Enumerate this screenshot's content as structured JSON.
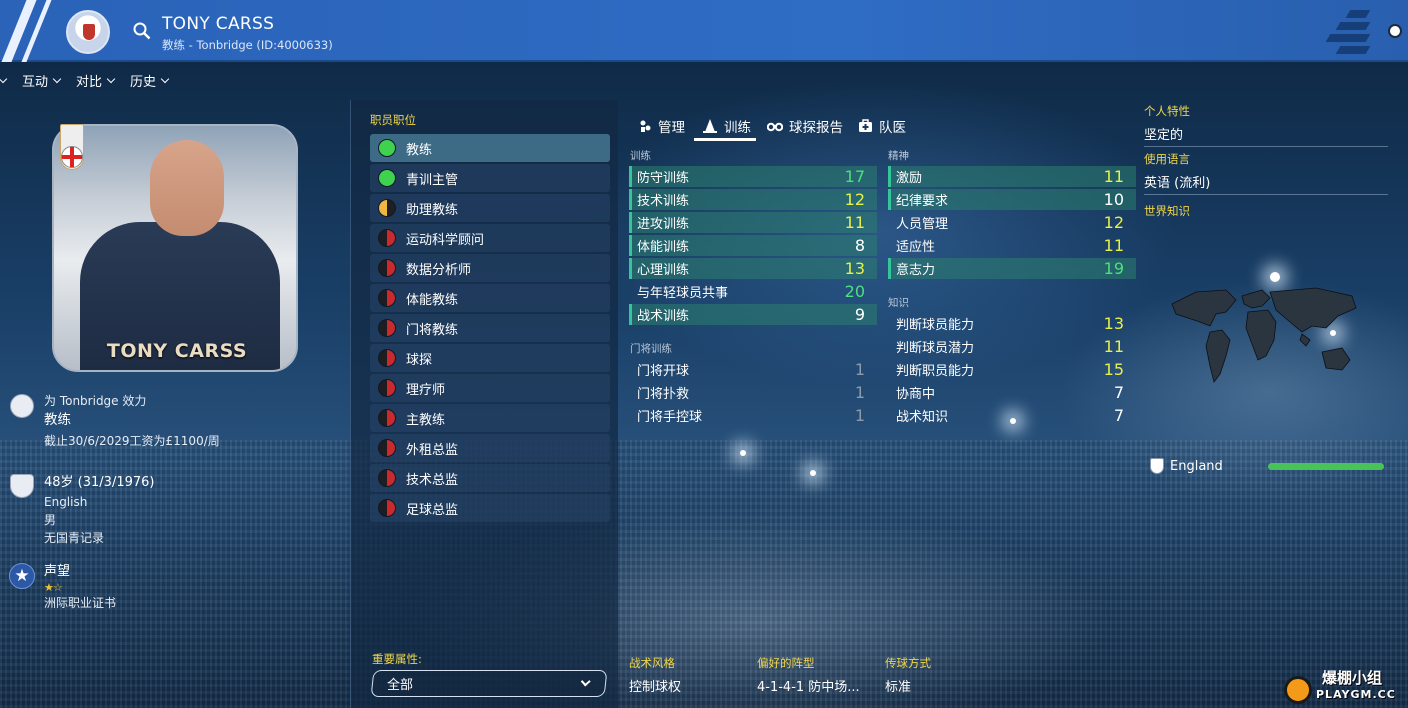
{
  "header": {
    "name": "TONY CARSS",
    "subtitle": "教练 - Tonbridge (ID:4000633)"
  },
  "nav": [
    "互动",
    "对比",
    "历史"
  ],
  "profile": {
    "photo_caption": "TONY CARSS",
    "club_line": "为 Tonbridge 效力",
    "role": "教练",
    "contract": "截止30/6/2029工资为£1100/周",
    "age": "48岁 (31/3/1976)",
    "nationality": "English",
    "gender": "男",
    "youth_record": "无国青记录",
    "reputation_label": "声望",
    "reputation_stars": "★☆",
    "reputation_stars_value": 1.5,
    "licence": "洲际职业证书"
  },
  "roles": {
    "title": "职员职位",
    "items": [
      {
        "label": "教练",
        "status": "green",
        "selected": true
      },
      {
        "label": "青训主管",
        "status": "green"
      },
      {
        "label": "助理教练",
        "status": "half"
      },
      {
        "label": "运动科学顾问",
        "status": "red"
      },
      {
        "label": "数据分析师",
        "status": "red"
      },
      {
        "label": "体能教练",
        "status": "red"
      },
      {
        "label": "门将教练",
        "status": "red"
      },
      {
        "label": "球探",
        "status": "red"
      },
      {
        "label": "理疗师",
        "status": "red"
      },
      {
        "label": "主教练",
        "status": "red"
      },
      {
        "label": "外租总监",
        "status": "red"
      },
      {
        "label": "技术总监",
        "status": "red"
      },
      {
        "label": "足球总监",
        "status": "red"
      }
    ],
    "key_attributes_label": "重要属性:",
    "key_attributes_value": "全部"
  },
  "tabs": [
    "管理",
    "训练",
    "球探报告",
    "队医"
  ],
  "training": {
    "title": "训练",
    "items": [
      {
        "label": "防守训练",
        "value": "17"
      },
      {
        "label": "技术训练",
        "value": "12"
      },
      {
        "label": "进攻训练",
        "value": "11"
      },
      {
        "label": "体能训练",
        "value": "8"
      },
      {
        "label": "心理训练",
        "value": "13"
      },
      {
        "label": "与年轻球员共事",
        "value": "20"
      },
      {
        "label": "战术训练",
        "value": "9"
      }
    ]
  },
  "gk_training": {
    "title": "门将训练",
    "items": [
      {
        "label": "门将开球",
        "value": "1"
      },
      {
        "label": "门将扑救",
        "value": "1"
      },
      {
        "label": "门将手控球",
        "value": "1"
      }
    ]
  },
  "mental": {
    "title": "精神",
    "items": [
      {
        "label": "激励",
        "value": "11"
      },
      {
        "label": "纪律要求",
        "value": "10"
      },
      {
        "label": "人员管理",
        "value": "12"
      },
      {
        "label": "适应性",
        "value": "11"
      },
      {
        "label": "意志力",
        "value": "19"
      }
    ]
  },
  "knowledge": {
    "title": "知识",
    "items": [
      {
        "label": "判断球员能力",
        "value": "13"
      },
      {
        "label": "判断球员潜力",
        "value": "11"
      },
      {
        "label": "判断职员能力",
        "value": "15"
      },
      {
        "label": "协商中",
        "value": "7"
      },
      {
        "label": "战术知识",
        "value": "7"
      }
    ]
  },
  "right": {
    "personality_title": "个人特性",
    "personality": "坚定的",
    "language_title": "使用语言",
    "language": "英语 (流利)",
    "world_title": "世界知识",
    "country": "England",
    "country_knowledge": 1.0
  },
  "bottom": {
    "style_title": "战术风格",
    "style_value": "控制球权",
    "formation_title": "偏好的阵型",
    "formation_value": "4-1-4-1 防中场...",
    "passing_title": "传球方式",
    "passing_value": "标准"
  },
  "watermark": {
    "line1": "爆棚小组",
    "line2": "PLAYGM.CC"
  },
  "colors": {
    "accent": "#2f6cc4",
    "highlight": "#36c59a",
    "yellow": "#f0d64a"
  },
  "icons": [
    "search-icon",
    "ball-icon",
    "club-badge-icon",
    "england-flag-icon",
    "star-icon",
    "world-map-icon"
  ]
}
